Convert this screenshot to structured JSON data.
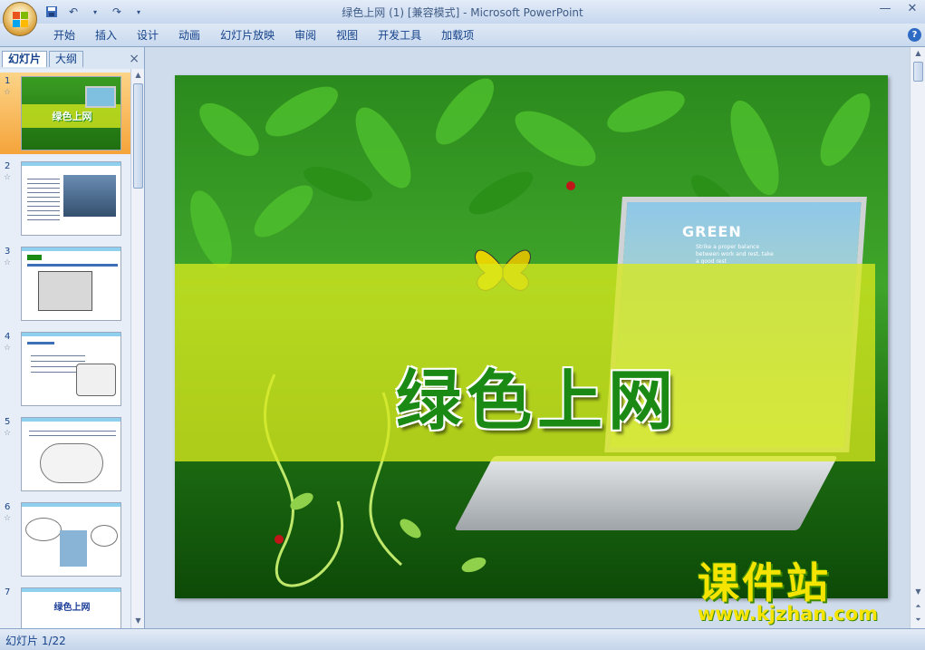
{
  "window": {
    "title": "绿色上网 (1) [兼容模式] - Microsoft PowerPoint",
    "minimize_icon": "minimize-icon",
    "close_icon": "close-icon"
  },
  "qat": {
    "save_icon": "save-icon",
    "undo_icon": "undo-icon",
    "redo_icon": "redo-icon",
    "customize_icon": "dropdown-arrow-icon"
  },
  "ribbon": {
    "tabs": [
      "开始",
      "插入",
      "设计",
      "动画",
      "幻灯片放映",
      "审阅",
      "视图",
      "开发工具",
      "加载项"
    ],
    "help_icon": "help-icon",
    "help_label": "?"
  },
  "left_pane": {
    "tabs": [
      "幻灯片",
      "大纲"
    ],
    "active_tab": "幻灯片",
    "close_label": "×",
    "thumbnails": [
      {
        "number": "1",
        "star": "☆",
        "selected": true
      },
      {
        "number": "2",
        "star": "☆",
        "selected": false
      },
      {
        "number": "3",
        "star": "☆",
        "selected": false
      },
      {
        "number": "4",
        "star": "☆",
        "selected": false
      },
      {
        "number": "5",
        "star": "☆",
        "selected": false
      },
      {
        "number": "6",
        "star": "☆",
        "selected": false
      },
      {
        "number": "7",
        "star": "",
        "selected": false
      }
    ],
    "thumb1_title": "绿色上网",
    "thumb7_title": "绿色上网"
  },
  "slide": {
    "title": "绿色上网",
    "laptop_text": "GREEN",
    "laptop_subtext": "Strike a proper balance between work and rest, take a good rest"
  },
  "watermark": {
    "title": "课件站",
    "url": "www.kjzhan.com"
  },
  "status": {
    "slide_counter": "幻灯片 1/22"
  },
  "colors": {
    "accent": "#15428b",
    "band": "#d7e81e",
    "title_green": "#1a8a15",
    "watermark_yellow": "#f4e400"
  }
}
